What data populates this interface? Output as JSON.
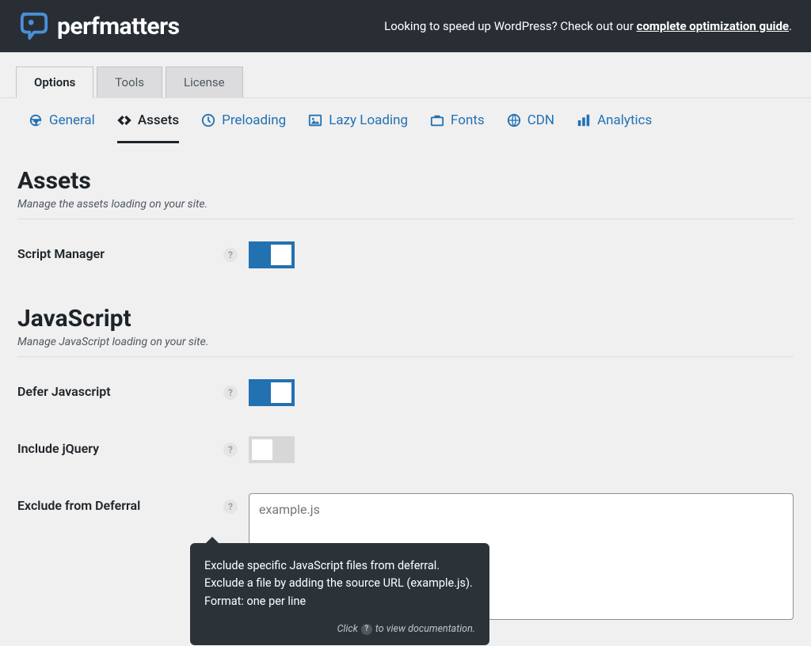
{
  "header": {
    "brand_name": "perfmatters",
    "promo_prefix": "Looking to speed up WordPress? Check out our ",
    "promo_link": "complete optimization guide",
    "promo_suffix": "."
  },
  "tabs": {
    "options": "Options",
    "tools": "Tools",
    "license": "License"
  },
  "subnav": {
    "general": "General",
    "assets": "Assets",
    "preloading": "Preloading",
    "lazy": "Lazy Loading",
    "fonts": "Fonts",
    "cdn": "CDN",
    "analytics": "Analytics"
  },
  "assets": {
    "title": "Assets",
    "desc": "Manage the assets loading on your site.",
    "script_manager_label": "Script Manager"
  },
  "javascript": {
    "title": "JavaScript",
    "desc": "Manage JavaScript loading on your site.",
    "defer_label": "Defer Javascript",
    "jquery_label": "Include jQuery",
    "exclude_label": "Exclude from Deferral",
    "exclude_placeholder": "example.js"
  },
  "tooltip": {
    "body": "Exclude specific JavaScript files from deferral. Exclude a file by adding the source URL (example.js). Format: one per line",
    "footer_prefix": "Click",
    "footer_suffix": "to view documentation."
  },
  "help_glyph": "?"
}
